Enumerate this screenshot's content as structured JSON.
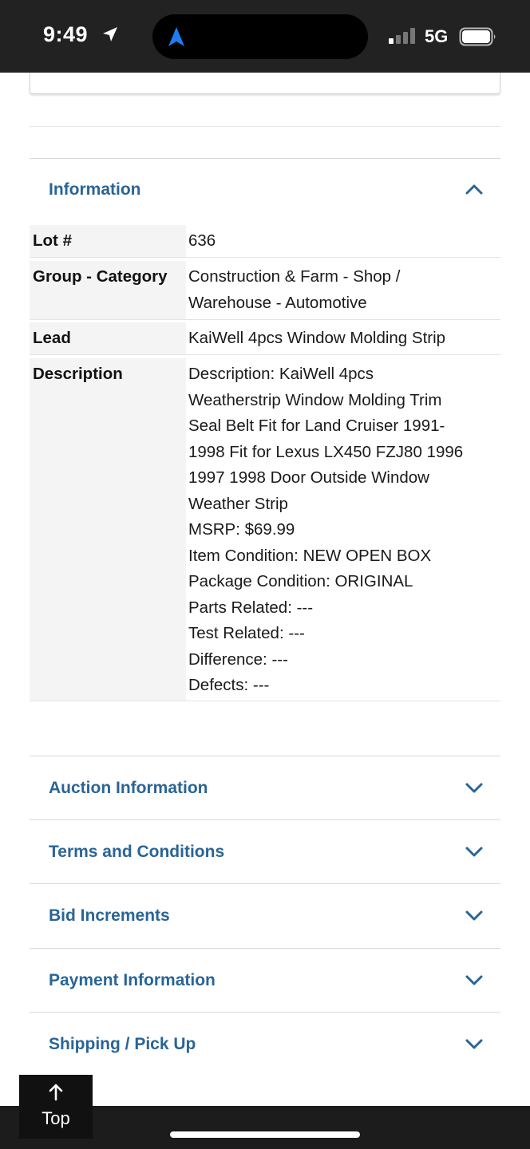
{
  "status_bar": {
    "time": "9:49",
    "network": "5G",
    "icons": [
      "location-arrow-icon",
      "navigation-arrow-icon",
      "signal-icon",
      "battery-icon"
    ]
  },
  "colors": {
    "accent": "#2a6496",
    "label_bg": "#f4f4f4",
    "status_bg": "#222222"
  },
  "information": {
    "title": "Information",
    "expanded": true,
    "rows": [
      {
        "label": "Lot #",
        "lines": [
          "636"
        ]
      },
      {
        "label": "Group - Category",
        "lines": [
          "Construction & Farm - Shop /",
          "Warehouse - Automotive"
        ]
      },
      {
        "label": "Lead",
        "lines": [
          "KaiWell 4pcs Window Molding Strip"
        ]
      },
      {
        "label": "Description",
        "lines": [
          "Description: KaiWell 4pcs",
          "Weatherstrip Window Molding Trim",
          "Seal Belt Fit for Land Cruiser 1991-",
          "1998 Fit for Lexus LX450 FZJ80 1996",
          "1997 1998 Door Outside Window",
          "Weather Strip",
          "MSRP: $69.99",
          "Item Condition: NEW OPEN BOX",
          "Package Condition: ORIGINAL",
          "Parts Related: ---",
          "Test Related: ---",
          "Difference: ---",
          "Defects: ---"
        ]
      }
    ]
  },
  "sections": [
    {
      "title": "Auction Information",
      "expanded": false
    },
    {
      "title": "Terms and Conditions",
      "expanded": false
    },
    {
      "title": "Bid Increments",
      "expanded": false
    },
    {
      "title": "Payment Information",
      "expanded": false
    },
    {
      "title": "Shipping / Pick Up",
      "expanded": false
    }
  ],
  "top_button": {
    "label": "Top"
  }
}
